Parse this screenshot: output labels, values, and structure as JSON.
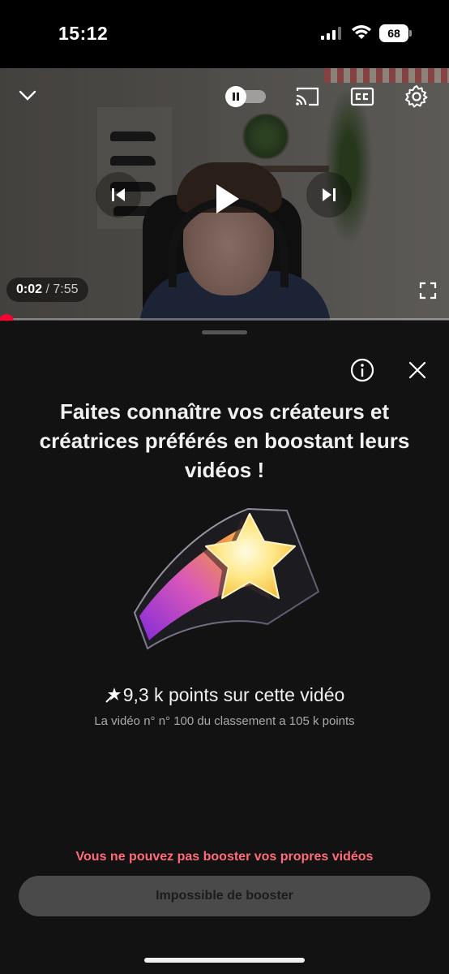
{
  "status_bar": {
    "time": "15:12",
    "battery": "68"
  },
  "player": {
    "time_current": "0:02",
    "time_separator": "/",
    "time_total": "7:55",
    "progress_fraction": 0.004,
    "icons": [
      "chevron-down-icon",
      "pause-icon",
      "cast-icon",
      "cc-icon",
      "gear-icon",
      "previous-icon",
      "play-icon",
      "next-icon",
      "fullscreen-icon"
    ]
  },
  "sheet": {
    "headline": "Faites connaître vos créateurs et créatrices préférés en boostant leurs vidéos !",
    "points_text": "9,3 k points sur cette vidéo",
    "rank_text": "La vidéo n° n° 100 du classement a 105 k points",
    "warning_text": "Vous ne pouvez pas booster vos propres vidéos",
    "boost_button_label": "Impossible de booster"
  },
  "colors": {
    "accent_red": "#ff0033",
    "warning_red": "#ff6b7a",
    "sheet_bg": "#121212",
    "button_bg": "#4a4a4a"
  }
}
